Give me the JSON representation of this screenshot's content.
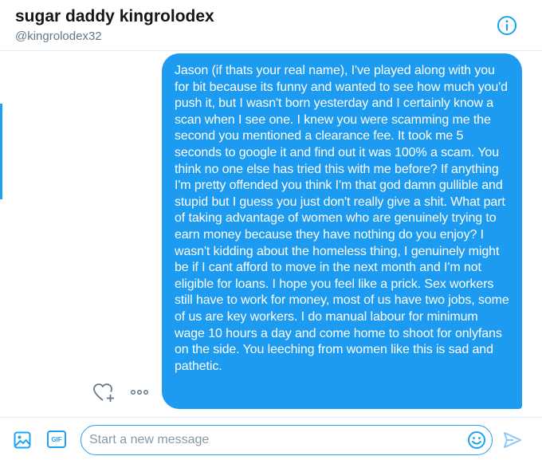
{
  "header": {
    "title": "sugar daddy kingrolodex",
    "handle": "@kingrolodex32",
    "info_icon": "info-icon"
  },
  "message": {
    "text": "Jason (if thats your real name), I've played along with you for bit because its funny and wanted to see how much you'd push it, but I wasn't born yesterday and I certainly know a scan when I see one. I knew you were scamming me the second you mentioned a clearance fee. It took me 5 seconds to google it and find out it was 100% a scam. You think no one else has tried this with me before? If anything I'm pretty offended you think I'm that god damn gullible and stupid but I guess you just don't really give a shit. What part of taking advantage of women who are genuinely trying to earn money because they have nothing do you enjoy? I wasn't kidding about the homeless thing, I genuinely might be if I cant afford to move in the next month and I'm not eligible for loans. I hope you feel like a prick. Sex workers still have to work for money, most of us have two jobs, some of us are key workers. I do manual labour for minimum wage 10 hours a day and come home to shoot for onlyfans on the side. You leeching from women like this is sad and pathetic.",
    "react_icon": "heart-plus-icon",
    "more_icon": "more-options-icon"
  },
  "composer": {
    "placeholder": "Start a new message",
    "value": "",
    "gif_label": "GIF",
    "media_icon": "image-icon",
    "emoji_icon": "emoji-icon",
    "send_icon": "send-icon"
  },
  "colors": {
    "accent": "#1da1f2",
    "bubble": "#1d9bf0",
    "muted": "#657786"
  }
}
